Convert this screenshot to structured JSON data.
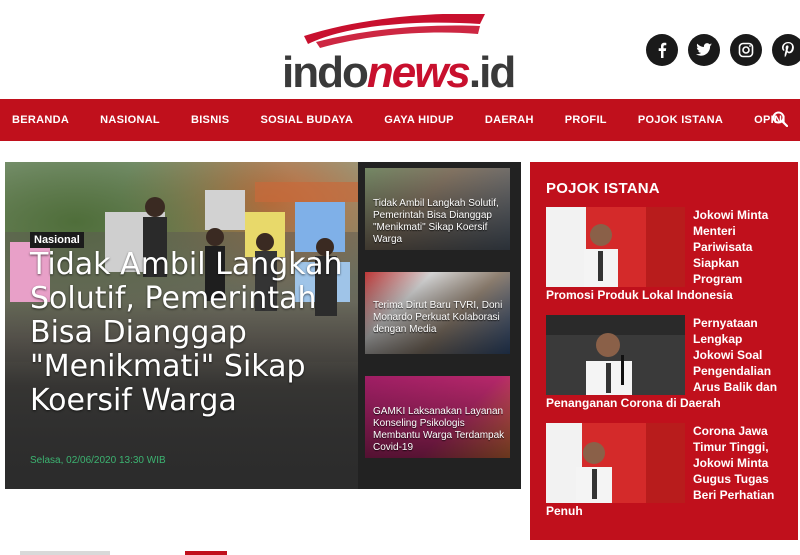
{
  "site": {
    "logo_text": {
      "part1": "indo",
      "part2": "news",
      "part3": ".id"
    },
    "social": [
      {
        "name": "facebook-icon",
        "glyph": "f"
      },
      {
        "name": "twitter-icon",
        "glyph": "t"
      },
      {
        "name": "instagram-icon",
        "glyph": "◎"
      },
      {
        "name": "pinterest-icon",
        "glyph": "P"
      }
    ]
  },
  "nav": {
    "items": [
      "BERANDA",
      "NASIONAL",
      "BISNIS",
      "SOSIAL BUDAYA",
      "GAYA HIDUP",
      "DAERAH",
      "PROFIL",
      "POJOK ISTANA",
      "OPINI"
    ],
    "search_icon": "search-icon"
  },
  "headline": {
    "category": "Nasional",
    "title": "Tidak Ambil Langkah Solutif, Pemerintah Bisa Dianggap \"Menikmati\" Sikap Koersif Warga",
    "date": "Selasa, 02/06/2020 13:30 WIB"
  },
  "side_news": [
    {
      "title": "Tidak Ambil Langkah Solutif, Pemerintah Bisa Dianggap \"Menikmati\" Sikap Koersif Warga"
    },
    {
      "title": "Terima Dirut Baru TVRI, Doni Monardo Perkuat Kolaborasi dengan Media"
    },
    {
      "title": "GAMKI Laksanakan Layanan Konseling Psikologis Membantu Warga Terdampak Covid-19",
      "image_caption": "Layanan Konseling Psikologis"
    }
  ],
  "pojok_istana": {
    "title": "POJOK ISTANA",
    "items": [
      {
        "title": "Jokowi Minta Menteri Pariwisata Siapkan Program Promosi Produk Lokal Indonesia"
      },
      {
        "title": "Pernyataan Lengkap Jokowi Soal Pengendalian Arus Balik dan Penanganan Corona di Daerah"
      },
      {
        "title": "Corona Jawa Timur Tinggi, Jokowi Minta Gugus Tugas Beri Perhatian Penuh"
      }
    ]
  },
  "colors": {
    "brand_red": "#c0101c",
    "dark_panel": "#222222",
    "date_green": "#3cb371"
  }
}
